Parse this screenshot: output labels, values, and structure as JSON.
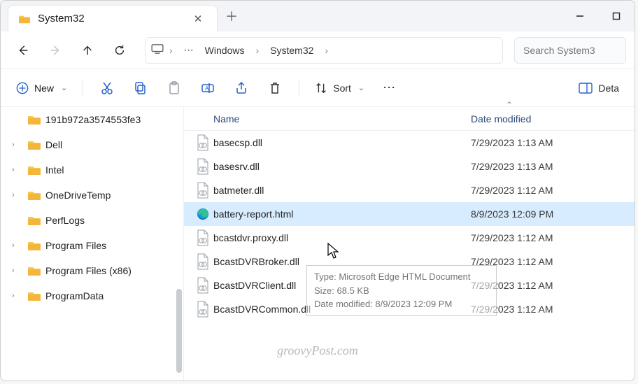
{
  "tab": {
    "title": "System32"
  },
  "breadcrumbs": {
    "seg1": "Windows",
    "seg2": "System32"
  },
  "search": {
    "placeholder": "Search System3"
  },
  "toolbar": {
    "new_label": "New",
    "sort_label": "Sort",
    "details_label": "Deta"
  },
  "columns": {
    "name": "Name",
    "date": "Date modified"
  },
  "tree": [
    {
      "label": "191b972a3574553fe3",
      "expandable": false
    },
    {
      "label": "Dell",
      "expandable": true
    },
    {
      "label": "Intel",
      "expandable": true
    },
    {
      "label": "OneDriveTemp",
      "expandable": true
    },
    {
      "label": "PerfLogs",
      "expandable": false
    },
    {
      "label": "Program Files",
      "expandable": true
    },
    {
      "label": "Program Files (x86)",
      "expandable": true
    },
    {
      "label": "ProgramData",
      "expandable": true
    }
  ],
  "files": [
    {
      "name": "basecsp.dll",
      "date": "7/29/2023 1:13 AM",
      "type": "dll",
      "sel": false
    },
    {
      "name": "basesrv.dll",
      "date": "7/29/2023 1:13 AM",
      "type": "dll",
      "sel": false
    },
    {
      "name": "batmeter.dll",
      "date": "7/29/2023 1:12 AM",
      "type": "dll",
      "sel": false
    },
    {
      "name": "battery-report.html",
      "date": "8/9/2023 12:09 PM",
      "type": "html",
      "sel": true
    },
    {
      "name": "bcastdvr.proxy.dll",
      "date": "7/29/2023 1:12 AM",
      "type": "dll",
      "sel": false
    },
    {
      "name": "BcastDVRBroker.dll",
      "date": "7/29/2023 1:12 AM",
      "type": "dll",
      "sel": false
    },
    {
      "name": "BcastDVRClient.dll",
      "date": "7/29/2023 1:12 AM",
      "type": "dll",
      "sel": false
    },
    {
      "name": "BcastDVRCommon.dll",
      "date": "7/29/2023 1:12 AM",
      "type": "dll",
      "sel": false
    }
  ],
  "tooltip": {
    "line1": "Type: Microsoft Edge HTML Document",
    "line2": "Size: 68.5 KB",
    "line3": "Date modified: 8/9/2023 12:09 PM"
  },
  "watermark": "groovyPost.com"
}
